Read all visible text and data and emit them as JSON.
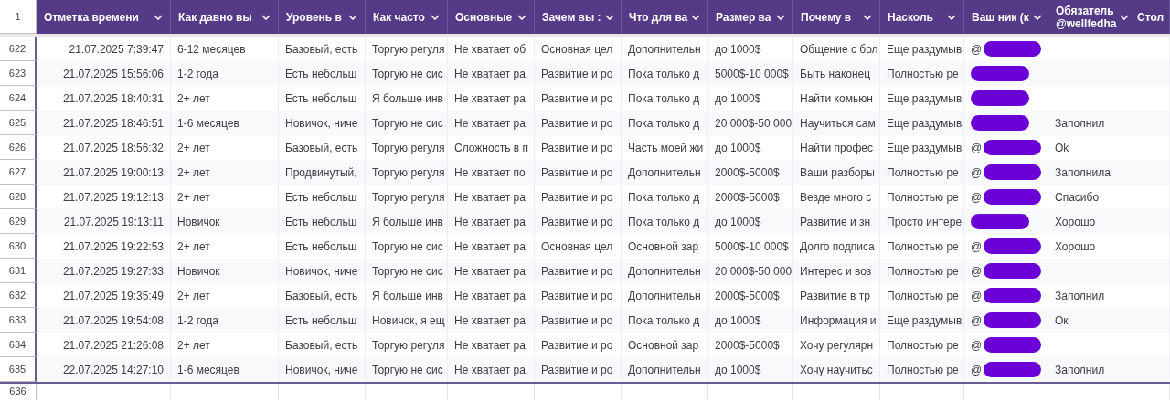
{
  "header": {
    "row_number": "1",
    "columns": [
      {
        "lines": [
          "Отметка времени"
        ]
      },
      {
        "lines": [
          "Как давно вы"
        ]
      },
      {
        "lines": [
          "Уровень в"
        ]
      },
      {
        "lines": [
          "Как часто"
        ]
      },
      {
        "lines": [
          "Основные"
        ]
      },
      {
        "lines": [
          "Зачем вы :"
        ]
      },
      {
        "lines": [
          "Что для ва"
        ]
      },
      {
        "lines": [
          "Размер ва"
        ]
      },
      {
        "lines": [
          "Почему в"
        ]
      },
      {
        "lines": [
          "Насколь"
        ]
      },
      {
        "lines": [
          "Ваш ник (к"
        ]
      },
      {
        "lines": [
          "Обязатель",
          "@wellfedha"
        ]
      },
      {
        "lines": [
          "Стол"
        ]
      }
    ]
  },
  "rows": [
    {
      "number": "622",
      "cells": [
        "21.07.2025 7:39:47",
        "6-12 месяцев",
        "Базовый, есть",
        "Торгую регуля",
        "Не хватает об",
        "Основная цел",
        "Дополнительн",
        "до 1000$",
        "Общение с бол",
        "Еще раздумыв"
      ],
      "nickname": {
        "prefix": "@",
        "redacted": true
      }
    },
    {
      "number": "623",
      "cells": [
        "21.07.2025 15:56:06",
        "1-2 года",
        "Есть небольш",
        "Торгую не сис",
        "Не хватает ра",
        "Развитие и ро",
        "Пока только д",
        "5000$-10 000$",
        "Быть наконец",
        "Полностью ре"
      ],
      "nickname": {
        "redacted": true
      }
    },
    {
      "number": "624",
      "cells": [
        "21.07.2025 18:40:31",
        "2+ лет",
        "Есть небольш",
        "Я больше инв",
        "Не хватает ра",
        "Развитие и ро",
        "Пока только д",
        "до 1000$",
        "Найти комьюн",
        "Еще раздумыв"
      ],
      "nickname": {
        "redacted": true
      }
    },
    {
      "number": "625",
      "cells": [
        "21.07.2025 18:46:51",
        "1-6 месяцев",
        "Новичок, ниче",
        "Торгую не сис",
        "Не хватает ра",
        "Развитие и ро",
        "Пока только д",
        "20 000$-50 000",
        "Научиться сам",
        "Еще раздумыв"
      ],
      "nickname": {
        "redacted": true
      },
      "note": "Заполнил"
    },
    {
      "number": "626",
      "cells": [
        "21.07.2025 18:56:32",
        "2+ лет",
        "Базовый, есть",
        "Торгую регуля",
        "Сложность в п",
        "Развитие и ро",
        "Часть моей жи",
        "до 1000$",
        "Найти профес",
        "Еще раздумыв"
      ],
      "nickname": {
        "prefix": "@",
        "redacted": true
      },
      "note": "Ok"
    },
    {
      "number": "627",
      "cells": [
        "21.07.2025 19:00:13",
        "2+ лет",
        "Продвинутый,",
        "Торгую регуля",
        "Не хватает по",
        "Развитие и ро",
        "Дополнительн",
        "2000$-5000$",
        "Ваши разборы",
        "Полностью ре"
      ],
      "nickname": {
        "prefix": "@",
        "redacted": true
      },
      "note": "Заполнила"
    },
    {
      "number": "628",
      "cells": [
        "21.07.2025 19:12:13",
        "2+ лет",
        "Есть небольш",
        "Торгую регуля",
        "Не хватает ра",
        "Развитие и ро",
        "Пока только д",
        "2000$-5000$",
        "Везде много с",
        "Полностью ре"
      ],
      "nickname": {
        "prefix": "@",
        "redacted": true
      },
      "note": "Спасибо"
    },
    {
      "number": "629",
      "cells": [
        "21.07.2025 19:13:11",
        "Новичок",
        "Есть небольш",
        "Я больше инв",
        "Не хватает ра",
        "Развитие и ро",
        "Пока только д",
        "до 1000$",
        "Развитие и зн",
        "Просто интере"
      ],
      "nickname": {
        "redacted": true
      },
      "note": "Хорошо"
    },
    {
      "number": "630",
      "cells": [
        "21.07.2025 19:22:53",
        "2+ лет",
        "Есть небольш",
        "Торгую не сис",
        "Не хватает ра",
        "Основная цел",
        "Основной зар",
        "5000$-10 000$",
        "Долго подписа",
        "Полностью ре"
      ],
      "nickname": {
        "prefix": "@",
        "redacted": true
      },
      "note": "Хорошо"
    },
    {
      "number": "631",
      "cells": [
        "21.07.2025 19:27:33",
        "Новичок",
        "Новичок, ниче",
        "Торгую не сис",
        "Не хватает ра",
        "Развитие и ро",
        "Дополнительн",
        "20 000$-50 000",
        "Интерес и воз",
        "Полностью ре"
      ],
      "nickname": {
        "prefix": "@",
        "redacted": true
      }
    },
    {
      "number": "632",
      "cells": [
        "21.07.2025 19:35:49",
        "2+ лет",
        "Базовый, есть",
        "Я больше инв",
        "Не хватает ра",
        "Развитие и ро",
        "Дополнительн",
        "2000$-5000$",
        "Развитие в тр",
        "Полностью ре"
      ],
      "nickname": {
        "prefix": "@",
        "redacted": true
      },
      "note": "Заполнил"
    },
    {
      "number": "633",
      "cells": [
        "21.07.2025 19:54:08",
        "1-2 года",
        "Есть небольш",
        "Новичок, я ещ",
        "Не хватает ра",
        "Развитие и ро",
        "Пока только д",
        "до 1000$",
        "Информация и",
        "Еще раздумыв"
      ],
      "nickname": {
        "prefix": "@",
        "redacted": true
      },
      "note": "Ок"
    },
    {
      "number": "634",
      "cells": [
        "21.07.2025 21:26:08",
        "2+ лет",
        "Базовый, есть",
        "Торгую регуля",
        "Не хватает ра",
        "Развитие и ро",
        "Основной зар",
        "2000$-5000$",
        "Хочу регулярн",
        "Полностью ре"
      ],
      "nickname": {
        "prefix": "@",
        "redacted": true
      }
    },
    {
      "number": "635",
      "cells": [
        "22.07.2025 14:27:10",
        "1-6 месяцев",
        "Новичок, ниче",
        "Торгую не сис",
        "Не хватает ра",
        "Развитие и ро",
        "Дополнительн",
        "до 1000$",
        "Хочу научитьс",
        "Полностью ре"
      ],
      "nickname": {
        "prefix": "@",
        "redacted": true
      },
      "note": "Заполнил"
    }
  ],
  "next_row_number": "636"
}
